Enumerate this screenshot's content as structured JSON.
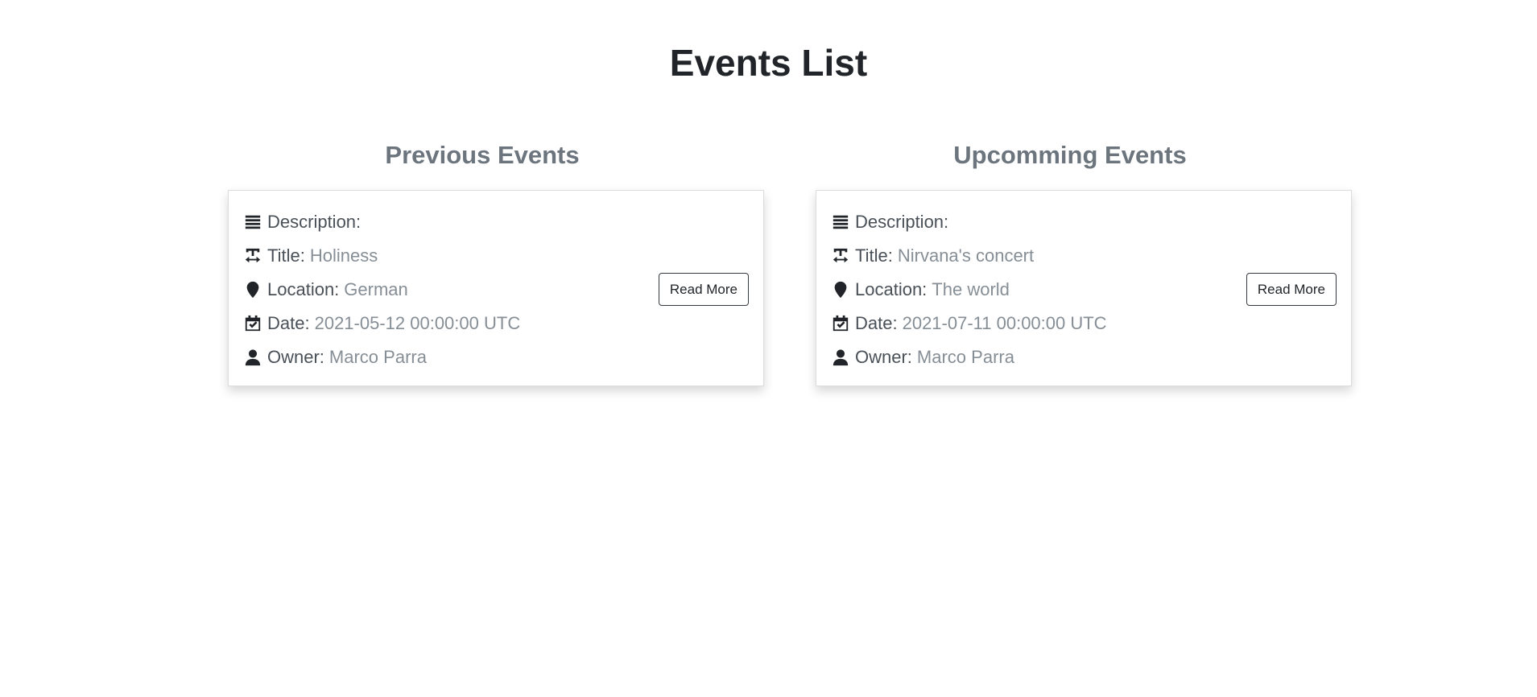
{
  "page": {
    "title": "Events List"
  },
  "labels": {
    "description": "Description:",
    "title": "Title:",
    "location": "Location:",
    "date": "Date:",
    "owner": "Owner:",
    "read_more": "Read More"
  },
  "previous": {
    "heading": "Previous Events",
    "event": {
      "description": "",
      "title": "Holiness",
      "location": "German",
      "date": "2021-05-12 00:00:00 UTC",
      "owner": "Marco Parra"
    }
  },
  "upcoming": {
    "heading": "Upcomming Events",
    "event": {
      "description": "",
      "title": "Nirvana's concert",
      "location": "The world",
      "date": "2021-07-11 00:00:00 UTC",
      "owner": "Marco Parra"
    }
  },
  "icons": {
    "description": "align-justify-icon",
    "title": "text-width-icon",
    "location": "map-marker-icon",
    "date": "calendar-check-icon",
    "owner": "user-icon"
  },
  "colors": {
    "heading": "#212529",
    "section_heading": "#6c757d",
    "value": "#868e96"
  }
}
